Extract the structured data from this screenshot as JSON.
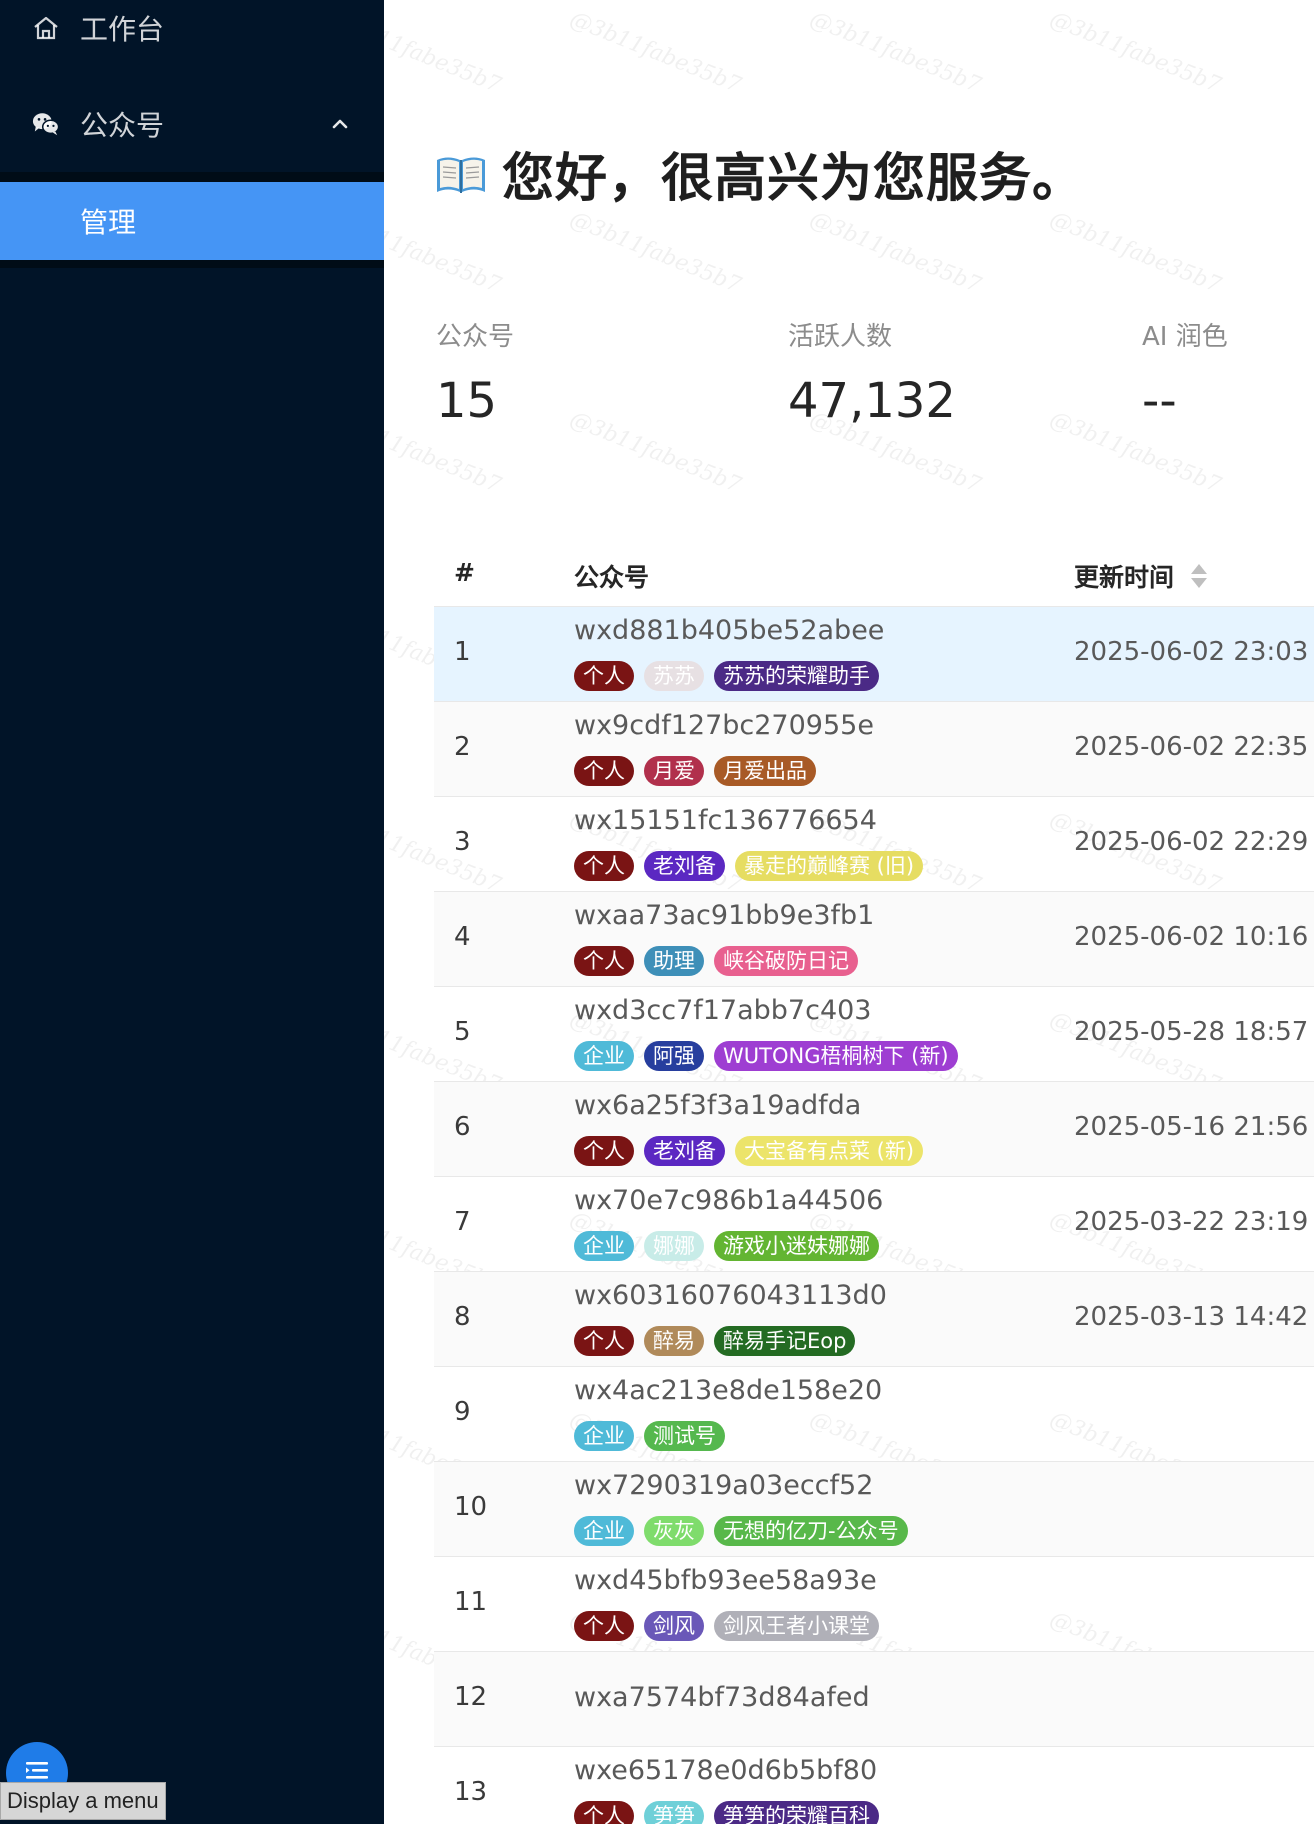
{
  "sidebar": {
    "workbench_label": "工作台",
    "official_label": "公众号",
    "manage_label": "管理",
    "tooltip": "Display a menu"
  },
  "header": {
    "greeting": "您好，很高兴为您服务。",
    "greeting_icon": "open-book-icon"
  },
  "stats": [
    {
      "label": "公众号",
      "value": "15"
    },
    {
      "label": "活跃人数",
      "value": "47,132"
    },
    {
      "label": "AI 润色",
      "value": "--"
    }
  ],
  "table": {
    "columns": [
      "#",
      "公众号",
      "更新时间"
    ],
    "rows": [
      {
        "num": "1",
        "id": "wxd881b405be52abee",
        "time": "2025-06-02 23:03",
        "tags": [
          {
            "text": "个人",
            "color": "#7a1414"
          },
          {
            "text": "苏苏",
            "color": "#e7e0e3"
          },
          {
            "text": "苏苏的荣耀助手",
            "color": "#4b2a86"
          }
        ]
      },
      {
        "num": "2",
        "id": "wx9cdf127bc270955e",
        "time": "2025-06-02 22:35",
        "tags": [
          {
            "text": "个人",
            "color": "#7a1414"
          },
          {
            "text": "月爱",
            "color": "#b1304c"
          },
          {
            "text": "月爱出品",
            "color": "#a85a26"
          }
        ]
      },
      {
        "num": "3",
        "id": "wx15151fc136776654",
        "time": "2025-06-02 22:29",
        "tags": [
          {
            "text": "个人",
            "color": "#7a1414"
          },
          {
            "text": "老刘备",
            "color": "#5b28c2"
          },
          {
            "text": "暴走的巅峰赛 (旧)",
            "color": "#e6dd62"
          }
        ]
      },
      {
        "num": "4",
        "id": "wxaa73ac91bb9e3fb1",
        "time": "2025-06-02 10:16",
        "tags": [
          {
            "text": "个人",
            "color": "#7a1414"
          },
          {
            "text": "助理",
            "color": "#3e8fb8"
          },
          {
            "text": "峡谷破防日记",
            "color": "#e8608f"
          }
        ]
      },
      {
        "num": "5",
        "id": "wxd3cc7f17abb7c403",
        "time": "2025-05-28 18:57",
        "tags": [
          {
            "text": "企业",
            "color": "#4fbad8"
          },
          {
            "text": "阿强",
            "color": "#273e9e"
          },
          {
            "text": "WUTONG梧桐树下 (新)",
            "color": "#9e3ed2"
          }
        ]
      },
      {
        "num": "6",
        "id": "wx6a25f3f3a19adfda",
        "time": "2025-05-16 21:56",
        "tags": [
          {
            "text": "个人",
            "color": "#7a1414"
          },
          {
            "text": "老刘备",
            "color": "#5b28c2"
          },
          {
            "text": "大宝备有点菜 (新)",
            "color": "#ece46a"
          }
        ]
      },
      {
        "num": "7",
        "id": "wx70e7c986b1a44506",
        "time": "2025-03-22 23:19",
        "tags": [
          {
            "text": "企业",
            "color": "#4fbad8"
          },
          {
            "text": "娜娜",
            "color": "#c8ece8"
          },
          {
            "text": "游戏小迷妹娜娜",
            "color": "#63b532"
          }
        ]
      },
      {
        "num": "8",
        "id": "wx60316076043113d0",
        "time": "2025-03-13 14:42",
        "tags": [
          {
            "text": "个人",
            "color": "#7a1414"
          },
          {
            "text": "醉易",
            "color": "#b08a5a"
          },
          {
            "text": "醉易手记Eop",
            "color": "#246b23"
          }
        ]
      },
      {
        "num": "9",
        "id": "wx4ac213e8de158e20",
        "time": "",
        "tags": [
          {
            "text": "企业",
            "color": "#4fbad8"
          },
          {
            "text": "测试号",
            "color": "#55b84e"
          }
        ]
      },
      {
        "num": "10",
        "id": "wx7290319a03eccf52",
        "time": "",
        "tags": [
          {
            "text": "企业",
            "color": "#4fbad8"
          },
          {
            "text": "灰灰",
            "color": "#7fdc6c"
          },
          {
            "text": "无想的亿刀-公众号",
            "color": "#58b84a"
          }
        ]
      },
      {
        "num": "11",
        "id": "wxd45bfb93ee58a93e",
        "time": "",
        "tags": [
          {
            "text": "个人",
            "color": "#7a1414"
          },
          {
            "text": "剑风",
            "color": "#6a58b8"
          },
          {
            "text": "剑风王者小课堂",
            "color": "#b0b0b8"
          }
        ]
      },
      {
        "num": "12",
        "id": "wxa7574bf73d84afed",
        "time": "",
        "tags": []
      },
      {
        "num": "13",
        "id": "wxe65178e0d6b5bf80",
        "time": "",
        "tags": [
          {
            "text": "个人",
            "color": "#7a1414"
          },
          {
            "text": "笋笋",
            "color": "#6fd0d8"
          },
          {
            "text": "笋笋的荣耀百科",
            "color": "#4b2a86"
          }
        ]
      }
    ]
  },
  "watermark": "@3b11fabe35b7"
}
